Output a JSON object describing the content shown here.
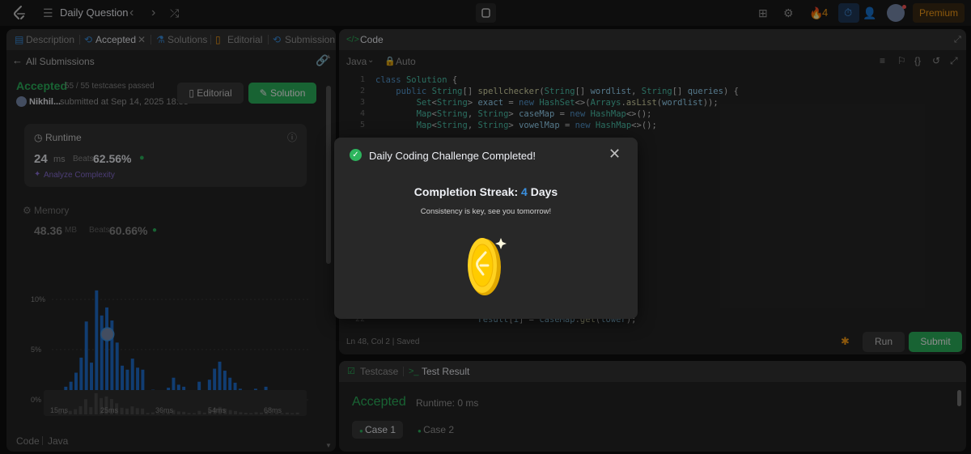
{
  "topbar": {
    "title": "Daily Question",
    "streak_count": "4",
    "premium": "Premium"
  },
  "left": {
    "tabs": [
      "Description",
      "Accepted",
      "Solutions",
      "Editorial",
      "Submission"
    ],
    "all_submissions": "All Submissions",
    "status": "Accepted",
    "testcases": "55 / 55 testcases passed",
    "user": "Nikhil...",
    "submitted": "submitted at Sep 14, 2025 18:55",
    "editorial_btn": "Editorial",
    "solution_btn": "Solution",
    "runtime": {
      "title": "Runtime",
      "value": "24",
      "unit": "ms",
      "beats": "Beats",
      "pct": "62.56%"
    },
    "analyze": "Analyze Complexity",
    "memory": {
      "title": "Memory",
      "value": "48.36",
      "unit": "MB",
      "beats": "Beats",
      "pct": "60.66%"
    },
    "footer_code": "Code",
    "footer_lang": "Java"
  },
  "chart_data": {
    "type": "bar",
    "yticks": [
      "10%",
      "5%",
      "0%"
    ],
    "xticks": [
      "15ms",
      "25ms",
      "36ms",
      "54ms",
      "68ms"
    ],
    "ylim": [
      0,
      10
    ],
    "highlight_index": 9,
    "values": [
      0.7,
      1.3,
      1.8,
      2.7,
      4.2,
      7.8,
      3.7,
      10.9,
      8.4,
      9.2,
      7.9,
      5.7,
      3.4,
      3.0,
      4.1,
      3.2,
      3.0,
      0.7,
      1.0,
      0.5,
      0.6,
      1.2,
      2.2,
      1.5,
      1.3,
      0.7,
      0.6,
      1.8,
      0.9,
      2.0,
      3.1,
      3.8,
      2.9,
      2.2,
      1.7,
      1.1,
      0.8,
      0.6,
      1.1,
      0.9,
      1.3,
      0.5,
      0.8,
      0.6,
      0.9,
      0.6,
      0.9
    ],
    "mini_xticks": [
      "15ms",
      "25ms",
      "36ms",
      "54ms",
      "68ms"
    ]
  },
  "code": {
    "title": "Code",
    "lang": "Java",
    "auto": "Auto",
    "lines": [
      {
        "n": "1",
        "html": "<span class=\"kw\">class</span> <span class=\"ty\">Solution</span> {"
      },
      {
        "n": "2",
        "html": "    <span class=\"kw\">public</span> <span class=\"ty\">String</span>[] <span class=\"fn\">spellchecker</span>(<span class=\"ty\">String</span>[] <span class=\"vr\">wordlist</span>, <span class=\"ty\">String</span>[] <span class=\"vr\">queries</span>) {"
      },
      {
        "n": "3",
        "html": "        <span class=\"ty\">Set</span>&lt;<span class=\"ty\">String</span>&gt; <span class=\"vr\">exact</span> = <span class=\"kw\">new</span> <span class=\"ty\">HashSet</span>&lt;&gt;(<span class=\"ty\">Arrays</span>.<span class=\"fn\">asList</span>(<span class=\"vr\">wordlist</span>));"
      },
      {
        "n": "4",
        "html": "        <span class=\"ty\">Map</span>&lt;<span class=\"ty\">String</span>, <span class=\"ty\">String</span>&gt; <span class=\"vr\">caseMap</span> = <span class=\"kw\">new</span> <span class=\"ty\">HashMap</span>&lt;&gt;();"
      },
      {
        "n": "5",
        "html": "        <span class=\"ty\">Map</span>&lt;<span class=\"ty\">String</span>, <span class=\"ty\">String</span>&gt; <span class=\"vr\">vowelMap</span> = <span class=\"kw\">new</span> <span class=\"ty\">HashMap</span>&lt;&gt;();"
      },
      {
        "n": "22",
        "html": "                    <span class=\"vr\">result</span>[<span class=\"vr\">i</span>] = <span class=\"vr\">caseMap</span>.<span class=\"fn\">get</span>(<span class=\"vr\">lower</span>);"
      }
    ],
    "status": "Ln 48, Col 2  |  Saved",
    "run": "Run",
    "submit": "Submit"
  },
  "test": {
    "tab_testcase": "Testcase",
    "tab_result": "Test Result",
    "accepted": "Accepted",
    "runtime": "Runtime: 0 ms",
    "case1": "Case 1",
    "case2": "Case 2"
  },
  "modal": {
    "title": "Daily Coding Challenge Completed!",
    "streak_label": "Completion Streak:",
    "streak_num": "4",
    "streak_unit": "Days",
    "message": "Consistency is key, see you tomorrow!"
  },
  "colors": {
    "accent_green": "#2db55d",
    "orange": "#ffa116",
    "bar_blue": "#1f6fd0",
    "streak_blue": "#3a90e0"
  }
}
